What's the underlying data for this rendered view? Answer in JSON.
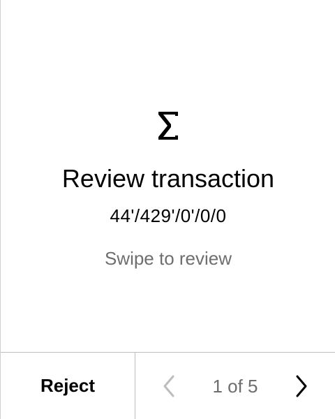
{
  "review": {
    "title": "Review transaction",
    "path": "44'/429'/0'/0/0",
    "hint": "Swipe to review",
    "icon": "sigma-icon"
  },
  "footer": {
    "reject_label": "Reject",
    "page_indicator": "1 of 5",
    "prev_icon": "chevron-left-icon",
    "next_icon": "chevron-right-icon"
  },
  "colors": {
    "text_primary": "#000000",
    "text_secondary": "#6e6e6e",
    "chevron_disabled": "#bdbdbd",
    "divider": "#bdbdbd"
  }
}
